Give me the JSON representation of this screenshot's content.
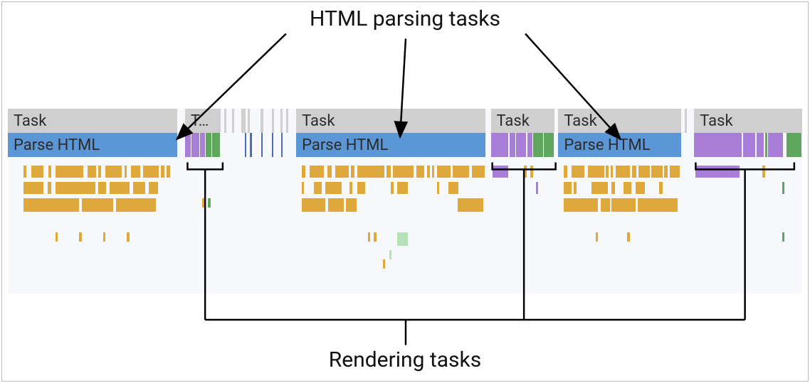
{
  "labels": {
    "top_title": "HTML parsing tasks",
    "bottom_title": "Rendering tasks",
    "task": "Task",
    "task_truncated": "T…",
    "parse_html": "Parse HTML"
  },
  "colors": {
    "task_bar": "#cfcfcf",
    "parse_bar": "#5b96d6",
    "render_purple": "#a87ed9",
    "render_green": "#5fa75f",
    "spark_yellow": "#dfa83a",
    "background": "#f6f8fb"
  }
}
